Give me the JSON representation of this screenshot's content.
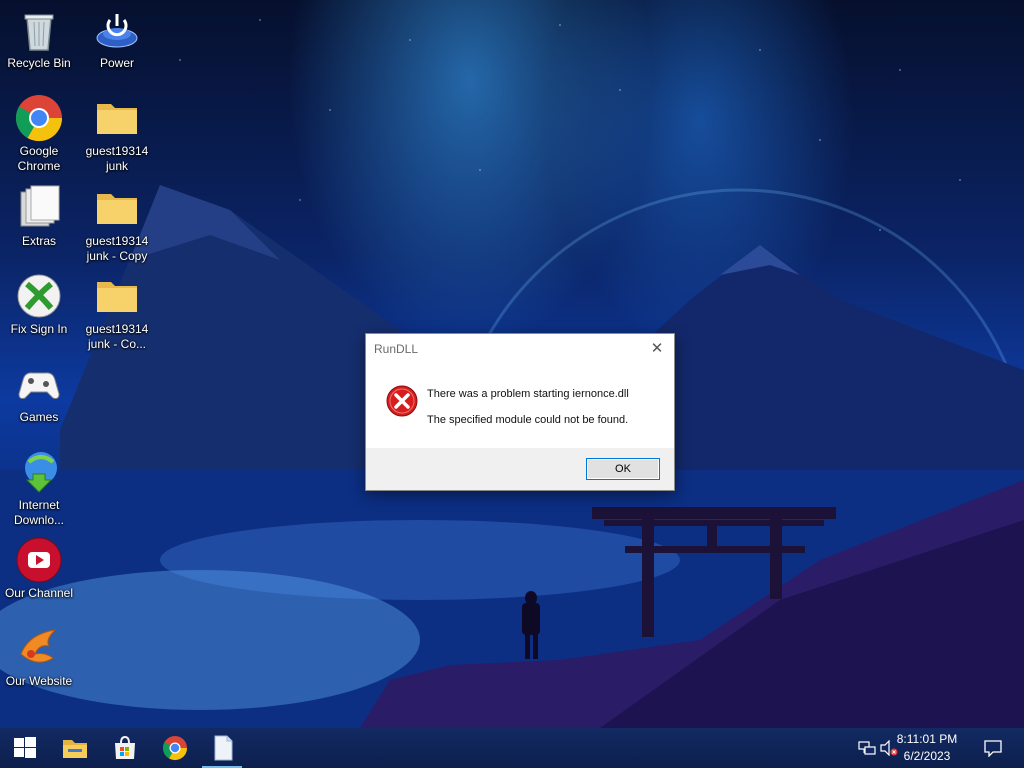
{
  "desktop": {
    "icons": [
      {
        "label": "Recycle Bin"
      },
      {
        "label": "Power"
      },
      {
        "label": "Google Chrome"
      },
      {
        "label": "guest19314 junk"
      },
      {
        "label": "Extras"
      },
      {
        "label": "guest19314 junk - Copy"
      },
      {
        "label": "Fix Sign In"
      },
      {
        "label": "guest19314 junk - Co..."
      },
      {
        "label": "Games"
      },
      {
        "label": "Internet Downlo..."
      },
      {
        "label": "Our Channel"
      },
      {
        "label": "Our Website"
      }
    ]
  },
  "dialog": {
    "title": "RunDLL",
    "close_glyph": "✕",
    "message_line1": "There was a problem starting iernonce.dll",
    "message_line2": "The specified module could not be found.",
    "ok_label": "OK",
    "icon": "error-icon"
  },
  "taskbar": {
    "items": [
      "start-icon",
      "file-explorer-icon",
      "store-icon",
      "chrome-icon",
      "notepad-icon"
    ],
    "clock": {
      "time": "8:11:01 PM",
      "date": "6/2/2023"
    },
    "tray": [
      "network-icon",
      "volume-muted-icon",
      "notification-icon"
    ]
  },
  "colors": {
    "accent": "#0078d7",
    "error_red": "#d71e1e",
    "taskbar": "#122a63"
  }
}
